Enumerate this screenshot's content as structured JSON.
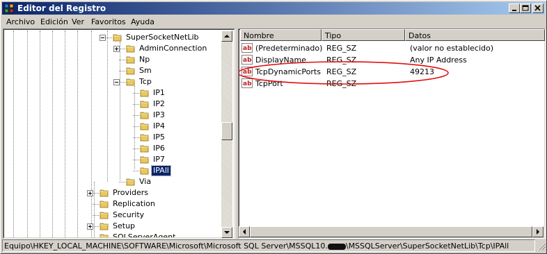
{
  "window": {
    "title": "Editor del Registro"
  },
  "menu": [
    "Archivo",
    "Edición",
    "Ver",
    "Favoritos",
    "Ayuda"
  ],
  "tree": {
    "items": [
      {
        "label": "SuperSocketNetLib",
        "expander": "minus"
      },
      {
        "label": "AdminConnection",
        "expander": "plus"
      },
      {
        "label": "Np",
        "expander": ""
      },
      {
        "label": "Sm",
        "expander": ""
      },
      {
        "label": "Tcp",
        "expander": "minus"
      },
      {
        "label": "IP1",
        "expander": ""
      },
      {
        "label": "IP2",
        "expander": ""
      },
      {
        "label": "IP3",
        "expander": ""
      },
      {
        "label": "IP4",
        "expander": ""
      },
      {
        "label": "IP5",
        "expander": ""
      },
      {
        "label": "IP6",
        "expander": ""
      },
      {
        "label": "IP7",
        "expander": ""
      },
      {
        "label": "IPAll",
        "expander": "",
        "selected": true
      },
      {
        "label": "Via",
        "expander": ""
      },
      {
        "label": "Providers",
        "expander": "plus"
      },
      {
        "label": "Replication",
        "expander": ""
      },
      {
        "label": "Security",
        "expander": ""
      },
      {
        "label": "Setup",
        "expander": "plus"
      },
      {
        "label": "SQLServerAgent",
        "expander": ""
      }
    ]
  },
  "list": {
    "headers": {
      "name": "Nombre",
      "type": "Tipo",
      "data": "Datos"
    },
    "rows": [
      {
        "name": "(Predeterminado)",
        "type": "REG_SZ",
        "data": "(valor no establecido)"
      },
      {
        "name": "DisplayName",
        "type": "REG_SZ",
        "data": "Any IP Address"
      },
      {
        "name": "TcpDynamicPorts",
        "type": "REG_SZ",
        "data": "49213"
      },
      {
        "name": "TcpPort",
        "type": "REG_SZ",
        "data": ""
      }
    ]
  },
  "status": {
    "path_before": "Equipo\\HKEY_LOCAL_MACHINE\\SOFTWARE\\Microsoft\\Microsoft SQL Server\\MSSQL10.",
    "path_after": "\\MSSQLServer\\SuperSocketNetLib\\Tcp\\IPAll"
  },
  "colors": {
    "titlebar_start": "#0a246a",
    "titlebar_end": "#a6caf0",
    "highlight_ellipse": "#e01010",
    "selection": "#0a246a"
  }
}
